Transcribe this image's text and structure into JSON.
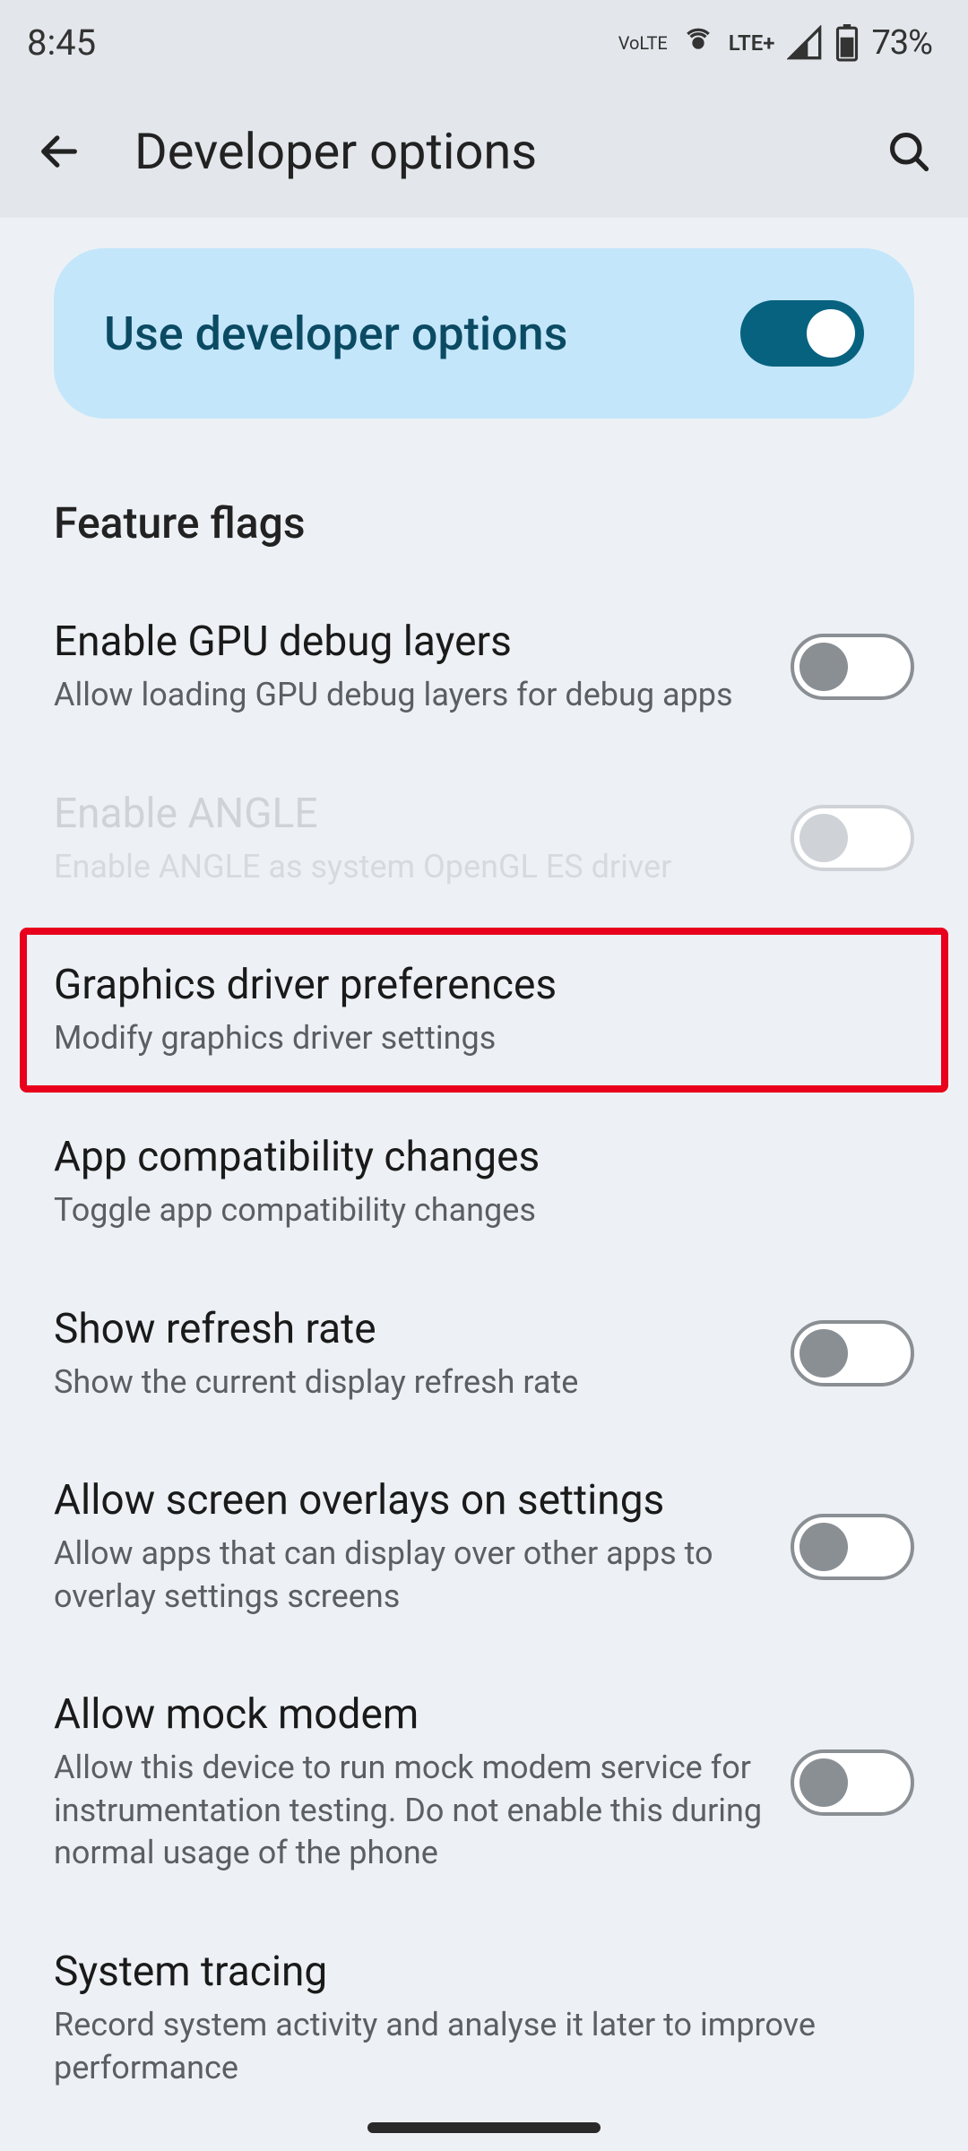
{
  "status": {
    "time": "8:45",
    "volte": "Vo LTE",
    "lte": "LTE+",
    "battery": "73%"
  },
  "header": {
    "title": "Developer options"
  },
  "hero": {
    "label": "Use developer options",
    "enabled": true
  },
  "section": {
    "title": "Feature flags"
  },
  "rows": {
    "gpu_debug": {
      "title": "Enable GPU debug layers",
      "sub": "Allow loading GPU debug layers for debug apps",
      "toggle": false
    },
    "angle": {
      "title": "Enable ANGLE",
      "sub": "Enable ANGLE as system OpenGL ES driver",
      "toggle": false,
      "disabled": true
    },
    "graphics_driver": {
      "title": "Graphics driver preferences",
      "sub": "Modify graphics driver settings"
    },
    "app_compat": {
      "title": "App compatibility changes",
      "sub": "Toggle app compatibility changes"
    },
    "refresh_rate": {
      "title": "Show refresh rate",
      "sub": "Show the current display refresh rate",
      "toggle": false
    },
    "screen_overlays": {
      "title": "Allow screen overlays on settings",
      "sub": "Allow apps that can display over other apps to overlay settings screens",
      "toggle": false
    },
    "mock_modem": {
      "title": "Allow mock modem",
      "sub": "Allow this device to run mock modem service for instrumentation testing. Do not enable this during normal usage of the phone",
      "toggle": false
    },
    "system_tracing": {
      "title": "System tracing",
      "sub": "Record system activity and analyse it later to improve performance"
    }
  }
}
